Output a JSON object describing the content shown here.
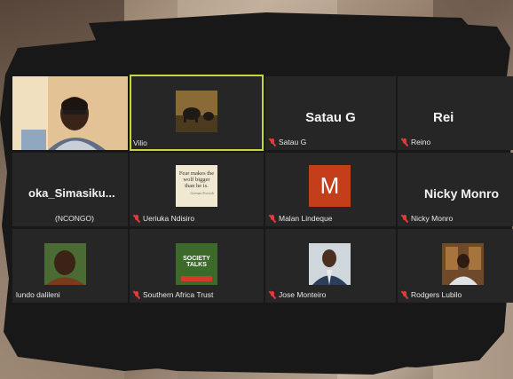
{
  "participants": [
    {
      "name": "",
      "muted": false,
      "type": "video"
    },
    {
      "name": "Vilio",
      "muted": false,
      "type": "image",
      "selected": true
    },
    {
      "name": "Satau G",
      "muted": true,
      "type": "text",
      "display": "Satau G"
    },
    {
      "name": "Reino",
      "muted": true,
      "type": "text",
      "display": "Rei"
    },
    {
      "name": "(NCONGO)",
      "muted": false,
      "type": "text",
      "display": "oka_Simasiku..."
    },
    {
      "name": "Ueriuka Ndisiro",
      "muted": true,
      "type": "quote",
      "quote_text": "Fear makes the wolf bigger than he is.",
      "quote_author": "German Proverb"
    },
    {
      "name": "Malan Lindeque",
      "muted": true,
      "type": "initial",
      "initial": "M"
    },
    {
      "name": "Nicky Monro",
      "muted": true,
      "type": "text",
      "display": "Nicky Monro"
    },
    {
      "name": "lundo dalileni",
      "muted": false,
      "type": "photo"
    },
    {
      "name": "Southern Africa Trust",
      "muted": true,
      "type": "logo",
      "logo_line1": "SOCIETY",
      "logo_line2": "TALKS"
    },
    {
      "name": "Jose Monteiro",
      "muted": true,
      "type": "photo"
    },
    {
      "name": "Rodgers Lubilo",
      "muted": true,
      "type": "photo"
    }
  ],
  "colors": {
    "accent_selected": "#c6d63a",
    "mic_muted": "#e23a3a",
    "tile_bg": "#262626",
    "initial_bg": "#c43e1c"
  },
  "icons": {
    "muted": "mic-off-icon"
  }
}
